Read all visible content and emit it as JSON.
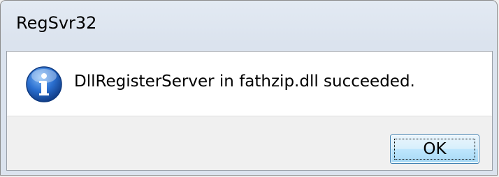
{
  "window": {
    "title": "RegSvr32"
  },
  "message": {
    "icon": "info-icon",
    "text": "DllRegisterServer in fathzip.dll succeeded."
  },
  "buttons": {
    "ok_label": "OK"
  },
  "colors": {
    "titlebar": "#dbe3ee",
    "content_bg": "#ffffff",
    "button_area_bg": "#f0f0f0",
    "icon_blue": "#1f5fbf",
    "button_border": "#3c7fb1"
  }
}
